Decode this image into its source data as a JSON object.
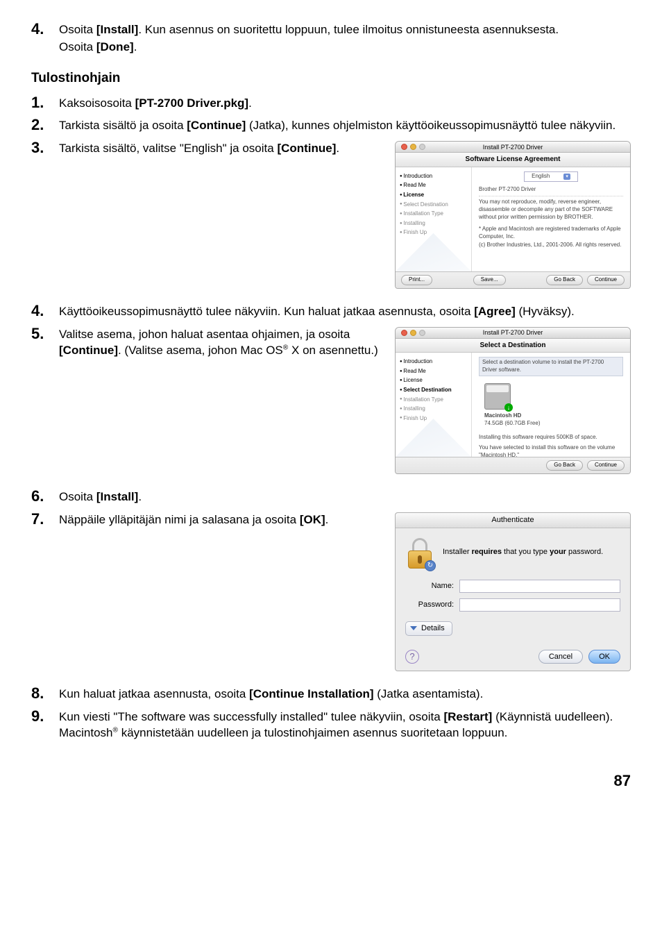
{
  "steps_top": {
    "s4": {
      "num": "4.",
      "line1_a": "Osoita ",
      "line1_b": "[Install]",
      "line1_c": ". Kun asennus on suoritettu loppuun, tulee ilmoitus onnistuneesta asennuksesta.",
      "line2_a": "Osoita ",
      "line2_b": "[Done]",
      "line2_c": "."
    }
  },
  "heading": "Tulostinohjain",
  "printer_steps": {
    "s1": {
      "num": "1.",
      "a": "Kaksoisosoita ",
      "b": "[PT-2700 Driver.pkg]",
      "c": "."
    },
    "s2": {
      "num": "2.",
      "a": "Tarkista sisältö ja osoita ",
      "b": "[Continue]",
      "c": " (Jatka), kunnes ohjelmiston käyttöoikeussopimusnäyttö tulee näkyviin."
    },
    "s3": {
      "num": "3.",
      "a": "Tarkista sisältö, valitse \"English\" ja osoita ",
      "b": "[Continue]",
      "c": "."
    },
    "s4": {
      "num": "4.",
      "a": "Käyttöoikeussopimusnäyttö tulee näkyviin. Kun haluat jatkaa asennusta, osoita ",
      "b": "[Agree]",
      "c": " (Hyväksy)."
    },
    "s5": {
      "num": "5.",
      "a": "Valitse asema, johon haluat asentaa ohjaimen, ja osoita ",
      "b": "[Continue]",
      "c": ". (Valitse asema, johon Mac OS",
      "sup": "®",
      "d": " X on asennettu.)"
    },
    "s6": {
      "num": "6.",
      "a": "Osoita ",
      "b": "[Install]",
      "c": "."
    },
    "s7": {
      "num": "7.",
      "a": "Näppäile ylläpitäjän nimi ja salasana ja osoita ",
      "b": "[OK]",
      "c": "."
    },
    "s8": {
      "num": "8.",
      "a": "Kun haluat jatkaa asennusta, osoita ",
      "b": "[Continue Installation]",
      "c": " (Jatka asentamista)."
    },
    "s9": {
      "num": "9.",
      "a": "Kun viesti \"The software was successfully installed\" tulee näkyviin, osoita ",
      "b": "[Restart]",
      "c": " (Käynnistä uudelleen). Macintosh",
      "sup": "®",
      "d": " käynnistetään uudelleen ja tulostinohjaimen asennus suoritetaan loppuun."
    }
  },
  "installer1": {
    "title": "Install PT-2700 Driver",
    "subtitle": "Software License Agreement",
    "lang": "English",
    "header": "Brother PT-2700 Driver",
    "body1": "You may not reproduce, modify, reverse engineer, disassemble or decompile any part of the SOFTWARE without prior written permission by BROTHER.",
    "body2": "* Apple and Macintosh are registered trademarks of Apple Computer, Inc.",
    "body3": "(c) Brother Industries, Ltd., 2001-2006. All rights reserved.",
    "sidebar": [
      "Introduction",
      "Read Me",
      "License",
      "Select Destination",
      "Installation Type",
      "Installing",
      "Finish Up"
    ],
    "btn_print": "Print...",
    "btn_save": "Save...",
    "btn_back": "Go Back",
    "btn_cont": "Continue"
  },
  "installer2": {
    "title": "Install PT-2700 Driver",
    "subtitle": "Select a Destination",
    "prompt": "Select a destination volume to install the PT-2700 Driver software.",
    "disk_name": "Macintosh HD",
    "disk_size": "74.5GB (60.7GB Free)",
    "space": "Installing this software requires 500KB of space.",
    "selected": "You have selected to install this software on the volume \"Macintosh HD.\"",
    "sidebar": [
      "Introduction",
      "Read Me",
      "License",
      "Select Destination",
      "Installation Type",
      "Installing",
      "Finish Up"
    ],
    "btn_back": "Go Back",
    "btn_cont": "Continue"
  },
  "auth": {
    "title": "Authenticate",
    "prompt_a": "Installer ",
    "prompt_b": "requires",
    "prompt_c": " that you type ",
    "prompt_d": "your",
    "prompt_e": " password.",
    "name": "Name:",
    "password": "Password:",
    "details": "Details",
    "cancel": "Cancel",
    "ok": "OK"
  },
  "page_number": "87"
}
